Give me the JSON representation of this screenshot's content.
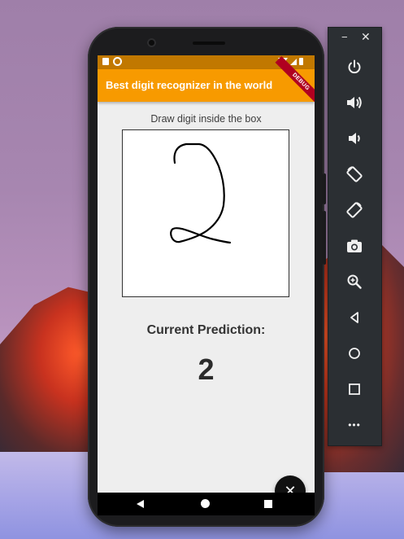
{
  "app": {
    "title": "Best digit recognizer in the world",
    "debug_banner": "DEBUG",
    "accent": "#f79a00"
  },
  "main": {
    "instruction": "Draw digit inside the box",
    "prediction_label": "Current Prediction:",
    "prediction_value": "2",
    "fab_icon": "close-icon"
  },
  "navbar": {
    "items": [
      "back-icon",
      "home-icon",
      "recents-icon"
    ]
  },
  "emulator_toolbar": {
    "window_controls": {
      "minimize": "−",
      "close": "✕"
    },
    "buttons": [
      "power-icon",
      "volume-up-icon",
      "volume-down-icon",
      "rotate-left-icon",
      "rotate-right-icon",
      "camera-icon",
      "zoom-icon",
      "back-icon",
      "home-icon",
      "overview-icon",
      "more-icon"
    ],
    "more_label": "•••"
  }
}
